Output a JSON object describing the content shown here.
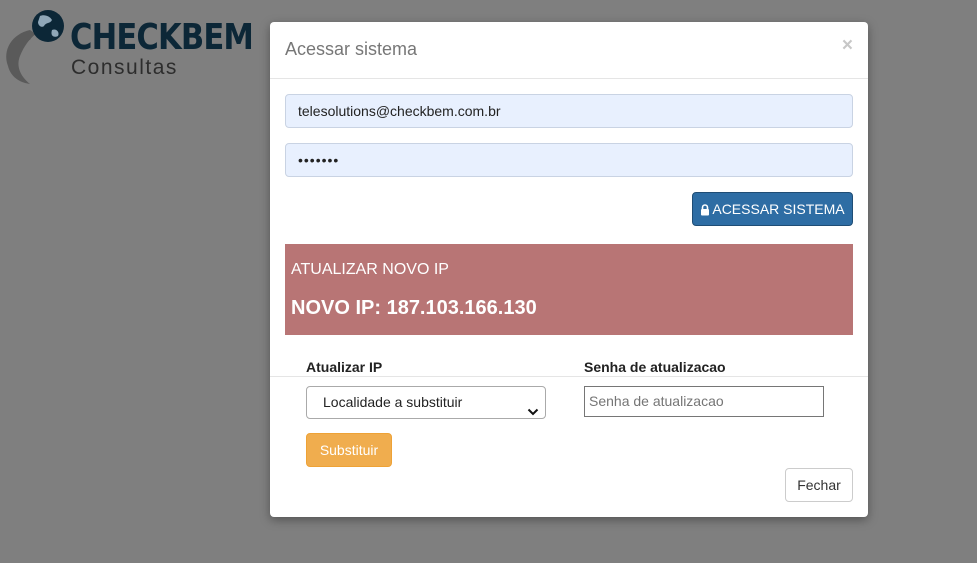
{
  "logo": {
    "main": "CHECKBEM",
    "sub": "Consultas"
  },
  "modal": {
    "title": "Acessar sistema",
    "close": "×",
    "email_value": "telesolutions@checkbem.com.br",
    "password_value": "•••••••",
    "login_button": "ACESSAR SISTEMA",
    "alert": {
      "line1": "ATUALIZAR NOVO IP",
      "line2": "NOVO IP: 187.103.166.130"
    },
    "update_ip_label": "Atualizar IP",
    "update_select_value": "Localidade a substituir",
    "update_password_label": "Senha de atualizacao",
    "update_password_placeholder": "Senha de atualizacao",
    "replace_button": "Substituir",
    "close_button": "Fechar"
  },
  "colors": {
    "overlay": "#7f7f7f",
    "primary": "#2e6da4",
    "warning": "#f0ad4e",
    "alert_bg": "#b87575"
  }
}
